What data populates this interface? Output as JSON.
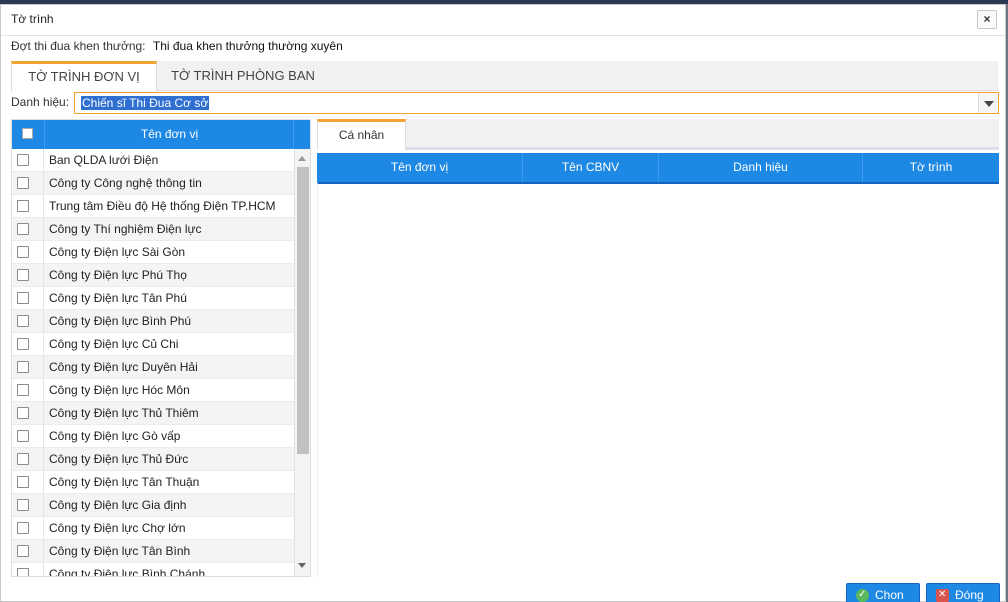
{
  "dialog": {
    "title": "Tờ trình",
    "close_symbol": "×"
  },
  "dot": {
    "label": "Đợt thi đua khen thưởng:",
    "value": "Thi đua khen thưởng thường xuyên"
  },
  "tabs": [
    {
      "label": "TỜ TRÌNH ĐƠN VỊ",
      "active": true
    },
    {
      "label": "TỜ TRÌNH PHÒNG BAN",
      "active": false
    }
  ],
  "danh_hieu": {
    "label": "Danh hiệu:",
    "value": "Chiến sĩ Thi Đua Cơ sở"
  },
  "left_grid": {
    "header": "Tên đơn vị",
    "rows": [
      "Ban QLDA lưới Điện",
      "Công ty Công nghệ thông tin",
      "Trung tâm Điều độ Hệ thống Điện TP.HCM",
      "Công ty Thí nghiệm Điện lực",
      "Công ty Điện lực Sài Gòn",
      "Công ty Điện lực Phú Thọ",
      "Công ty Điện lực Tân Phú",
      "Công ty Điện lực Bình Phú",
      "Công ty Điện lực Củ Chi",
      "Công ty Điện lực Duyên Hải",
      "Công ty Điện lực Hóc Môn",
      "Công ty Điện lực Thủ Thiêm",
      "Công ty Điện lực Gò vấp",
      "Công ty Điện lực Thủ Đức",
      "Công ty Điện lực Tân Thuận",
      "Công ty Điện lực Gia định",
      "Công ty Điện lực Chợ lớn",
      "Công ty Điện lực Tân Bình",
      "Công ty Điện lực Bình Chánh"
    ]
  },
  "right_panel": {
    "tab": "Cá nhân",
    "columns": [
      "Tên đơn vị",
      "Tên CBNV",
      "Danh hiệu",
      "Tờ trình"
    ]
  },
  "buttons": {
    "chon": "Chon",
    "dong": "Đóng"
  },
  "colors": {
    "accent_blue": "#1e88e5",
    "tab_accent": "#f1a334"
  }
}
